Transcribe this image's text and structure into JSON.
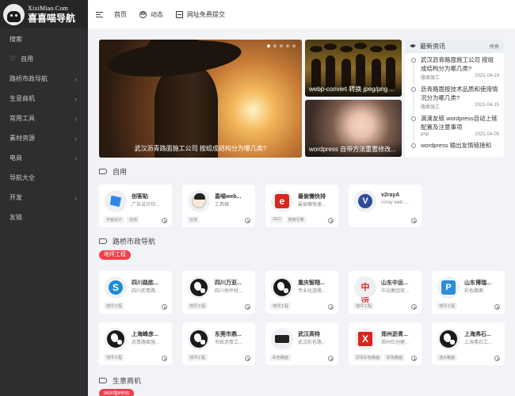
{
  "site": {
    "logo_en": "XixiMiao.Com",
    "logo_cn": "喜喜喵导航"
  },
  "sidebar": {
    "items": [
      {
        "label": "搜索",
        "icon": "",
        "arrow": false
      },
      {
        "label": "自用",
        "icon": "heart-icon",
        "arrow": false
      },
      {
        "label": "路桥市政导航",
        "icon": "",
        "arrow": true
      },
      {
        "label": "生意商机",
        "icon": "",
        "arrow": true
      },
      {
        "label": "常用工具",
        "icon": "",
        "arrow": true
      },
      {
        "label": "素材资源",
        "icon": "",
        "arrow": true
      },
      {
        "label": "电商",
        "icon": "",
        "arrow": true
      },
      {
        "label": "导航大全",
        "icon": "",
        "arrow": false
      },
      {
        "label": "开发",
        "icon": "",
        "arrow": true
      },
      {
        "label": "友链",
        "icon": "",
        "arrow": false
      }
    ]
  },
  "header": {
    "home": "首页",
    "dynamic": "动态",
    "submit": "网址免费提交"
  },
  "slider": {
    "caption": "武汉沥青路面施工公司 按组成结构分为哪几类?"
  },
  "pics": [
    {
      "caption": "webp-convert 转换 jpeg/png ..."
    },
    {
      "caption": "wordpress 自带方法重置修改..."
    }
  ],
  "news": {
    "title": "最新资讯",
    "all": "所有",
    "items": [
      {
        "title": "武汉沥青路面施工公司 按组成结构分为哪几类?",
        "cat": "路面施工",
        "date": "2021-04-19"
      },
      {
        "title": "沥青路面按技术品质和使用情况分为哪几类?",
        "cat": "路面施工",
        "date": "2021-04-15"
      },
      {
        "title": "滴滴友链 wordpress自动上链配置及注意事项",
        "cat": "php",
        "date": "2021-04-05"
      },
      {
        "title": "wordpress 输出友情链接和",
        "cat": "",
        "date": ""
      }
    ]
  },
  "sections": {
    "ziyong": "自用",
    "luqiao": "路桥市政导航",
    "shengyi": "生意商机"
  },
  "pills": {
    "luqiao": "地坪工程",
    "shengyi": "wordpress"
  },
  "cards_ziyong": [
    {
      "title": "创客贴",
      "desc": "广告设计印...",
      "tags": [
        "平面设计",
        "在线"
      ],
      "icon": "chuangketie-icon",
      "color": "#2d86e8"
    },
    {
      "title": "喜喵web...",
      "desc": "工具箱",
      "tags": [
        "在线"
      ],
      "icon": "cartoon-avatar-icon",
      "color": "#f5e9d5"
    },
    {
      "title": "最偷懒快排",
      "desc": "最偷懒快速...",
      "tags": [
        "SEO",
        "搜索引擎"
      ],
      "icon": "letter-e-icon",
      "color": "#d9261c"
    },
    {
      "title": "v2rayA",
      "desc": "v2ray web ...",
      "tags": [],
      "icon": "v2raya-icon",
      "color": "#2f4d9a"
    }
  ],
  "cards_luqiao": [
    {
      "title": "四川路胜...",
      "desc": "四川沥青路...",
      "tags": [
        "地坪工程"
      ],
      "icon": "s-logo-icon",
      "color": "#1f8ad8"
    },
    {
      "title": "四川万亚...",
      "desc": "四川地坪材...",
      "tags": [
        "地坪工程"
      ],
      "icon": "globe-icon",
      "color": "#1a1a1a"
    },
    {
      "title": "重庆智翔...",
      "desc": "专业化道路...",
      "tags": [
        "地坪工程"
      ],
      "icon": "globe-icon",
      "color": "#1a1a1a"
    },
    {
      "title": "山东中运...",
      "desc": "中运集团官...",
      "tags": [
        "地坪工程"
      ],
      "icon": "zhongyun-icon",
      "color": "#d9261c"
    },
    {
      "title": "山东博瑞...",
      "desc": "彩色路面",
      "tags": [
        "地坪工程"
      ],
      "icon": "p-logo-icon",
      "color": "#2b8fd6"
    },
    {
      "title": "上海峰彦...",
      "desc": "沥青路面施...",
      "tags": [
        "地坪工程"
      ],
      "icon": "globe-icon",
      "color": "#1a1a1a"
    },
    {
      "title": "东莞市鼎...",
      "desc": "市政沥青工...",
      "tags": [
        "地坪工程"
      ],
      "icon": "globe-icon",
      "color": "#1a1a1a"
    },
    {
      "title": "武汉高特",
      "desc": "武汉彩色路...",
      "tags": [
        "彩色路面"
      ],
      "icon": "gaote-icon",
      "color": "#222222"
    },
    {
      "title": "郑州沥青...",
      "desc": "郑州仕创建...",
      "tags": [
        "沥青彩色路面",
        "彩色路面"
      ],
      "icon": "x-logo-icon",
      "color": "#d9261c"
    },
    {
      "title": "上海弗石...",
      "desc": "上海弗石工...",
      "tags": [
        "透水路面"
      ],
      "icon": "globe-icon",
      "color": "#1a1a1a"
    }
  ]
}
